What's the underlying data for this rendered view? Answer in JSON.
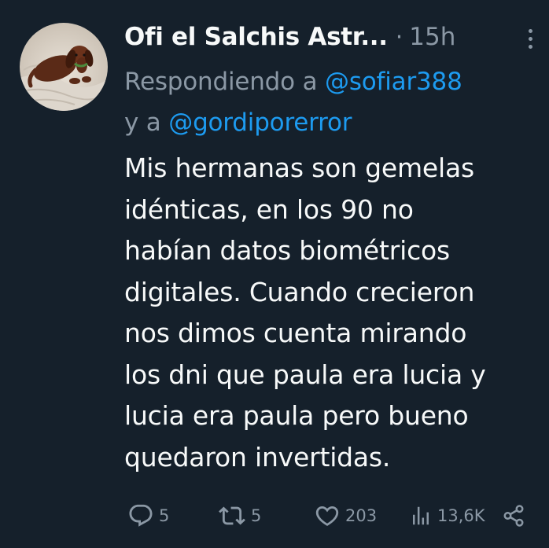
{
  "author": {
    "display_name": "Ofi el Salchis Astr...",
    "timestamp": "15h",
    "avatar_icon": "dachshund-avatar"
  },
  "reply": {
    "prefix": "Respondiendo a",
    "mention1": "@sofiar388",
    "connector": "y a",
    "mention2": "@gordiporerror"
  },
  "body": {
    "lines": [
      "Mis hermanas son gemelas",
      "idénticas, en los 90 no",
      "habían datos biométricos",
      "digitales. Cuando crecieron",
      "nos dimos cuenta mirando",
      "los dni que paula era lucia y",
      "lucia era paula pero bueno",
      "quedaron invertidas."
    ]
  },
  "actions": {
    "reply_count": "5",
    "retweet_count": "5",
    "like_count": "203",
    "views_count": "13,6K",
    "icons": [
      "reply-icon",
      "retweet-icon",
      "like-icon",
      "views-icon",
      "share-icon"
    ]
  },
  "colors": {
    "background": "#15202b",
    "text": "#f7f9f9",
    "muted": "#8b98a5",
    "link": "#1d9bf0"
  }
}
